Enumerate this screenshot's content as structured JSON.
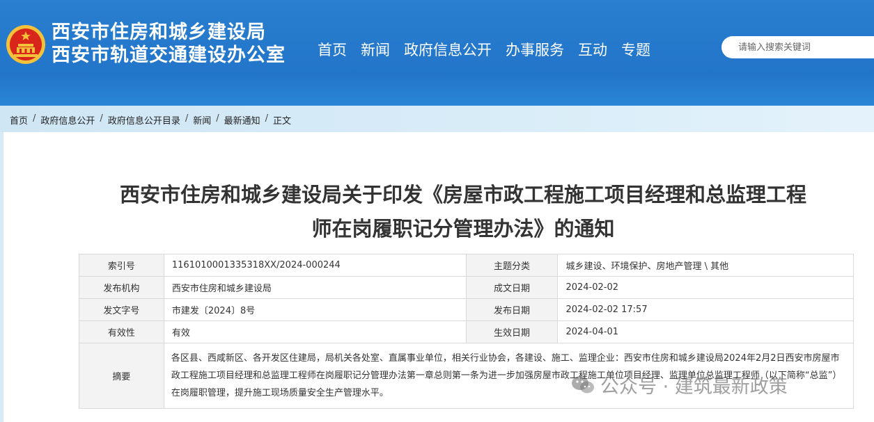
{
  "header": {
    "org_name_1": "西安市住房和城乡建设局",
    "org_name_2": "西安市轨道交通建设办公室",
    "nav": [
      "首页",
      "新闻",
      "政府信息公开",
      "办事服务",
      "互动",
      "专题"
    ],
    "search_placeholder": "请输入搜索关键词",
    "colors": {
      "banner": "#2275c9",
      "emblem_red": "#d8261b",
      "emblem_gold": "#f3c23a"
    }
  },
  "breadcrumb": {
    "items": [
      "首页",
      "政府信息公开",
      "政府信息公开目录",
      "新闻",
      "最新通知",
      "正文"
    ],
    "separator": "/"
  },
  "article": {
    "title_line1": "西安市住房和城乡建设局关于印发《房屋市政工程施工项目经理和总监理工程",
    "title_line2": "师在岗履职记分管理办法》的通知"
  },
  "meta": {
    "index_label": "索引号",
    "index_value": "1161010001335318XX/2024-000244",
    "topic_label": "主题分类",
    "topic_value": "城乡建设、环境保护、房地产管理 \\ 其他",
    "issuer_label": "发布机构",
    "issuer_value": "西安市住房和城乡建设局",
    "created_label": "成文日期",
    "created_value": "2024-02-02",
    "docno_label": "发文字号",
    "docno_value": "市建发〔2024〕8号",
    "published_label": "发布日期",
    "published_value": "2024-02-02 17:57",
    "validity_label": "有效性",
    "validity_value": "有效",
    "effective_label": "生效日期",
    "effective_value": "2024-04-01",
    "abstract_label": "摘要",
    "abstract_value": "各区县、西咸新区、各开发区住建局，局机关各处室、直属事业单位，相关行业协会，各建设、施工、监理企业：西安市住房和城乡建设局2024年2月2日西安市房屋市政工程施工项目经理和总监理工程师在岗履职记分管理办法第一章总则第一条为进一步加强房屋市政工程施工单位项目经理、监理单位总监理工程师（以下简称“总监”）在岗履职管理，提升施工现场质量安全生产管理水平。"
  },
  "watermark": {
    "text": "公众号 · 建筑最新政策",
    "icon": "wechat-icon"
  }
}
